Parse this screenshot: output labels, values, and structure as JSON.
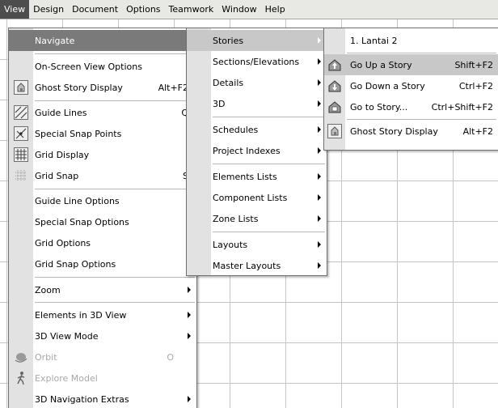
{
  "menubar": {
    "items": [
      "View",
      "Design",
      "Document",
      "Options",
      "Teamwork",
      "Window",
      "Help"
    ]
  },
  "view_menu": {
    "items": [
      {
        "label": "Navigate",
        "shortcut": "",
        "submenu": true
      },
      {
        "label": "On-Screen View Options",
        "shortcut": "",
        "submenu": true
      },
      {
        "label": "Ghost Story Display",
        "shortcut": "Alt+F2",
        "submenu": false
      },
      {
        "label": "Guide Lines",
        "shortcut": "Q",
        "submenu": false
      },
      {
        "label": "Special Snap Points",
        "shortcut": "",
        "submenu": false
      },
      {
        "label": "Grid Display",
        "shortcut": "",
        "submenu": false
      },
      {
        "label": "Grid Snap",
        "shortcut": "S",
        "submenu": false
      },
      {
        "label": "Guide Line Options",
        "shortcut": "",
        "submenu": true
      },
      {
        "label": "Special Snap Options",
        "shortcut": "",
        "submenu": true
      },
      {
        "label": "Grid Options",
        "shortcut": "",
        "submenu": true
      },
      {
        "label": "Grid Snap Options",
        "shortcut": "",
        "submenu": true
      },
      {
        "label": "Zoom",
        "shortcut": "",
        "submenu": true
      },
      {
        "label": "Elements in 3D View",
        "shortcut": "",
        "submenu": true
      },
      {
        "label": "3D View Mode",
        "shortcut": "",
        "submenu": true
      },
      {
        "label": "Orbit",
        "shortcut": "O",
        "submenu": false,
        "disabled": true
      },
      {
        "label": "Explore Model",
        "shortcut": "",
        "submenu": false,
        "disabled": true
      },
      {
        "label": "3D Navigation Extras",
        "shortcut": "",
        "submenu": true
      }
    ]
  },
  "navigate_menu": {
    "items": [
      {
        "label": "Stories"
      },
      {
        "label": "Sections/Elevations"
      },
      {
        "label": "Details"
      },
      {
        "label": "3D"
      },
      {
        "label": "Schedules"
      },
      {
        "label": "Project Indexes"
      },
      {
        "label": "Elements Lists"
      },
      {
        "label": "Component Lists"
      },
      {
        "label": "Zone Lists"
      },
      {
        "label": "Layouts"
      },
      {
        "label": "Master Layouts"
      }
    ]
  },
  "stories_menu": {
    "items": [
      {
        "label": "1. Lantai 2",
        "shortcut": ""
      },
      {
        "label": "Go Up a Story",
        "shortcut": "Shift+F2"
      },
      {
        "label": "Go Down a Story",
        "shortcut": "Ctrl+F2"
      },
      {
        "label": "Go to Story...",
        "shortcut": "Ctrl+Shift+F2"
      },
      {
        "label": "Ghost Story Display",
        "shortcut": "Alt+F2"
      }
    ]
  },
  "colors": {
    "highlight": "#7a7a7a",
    "highlight_light": "#c8c8c8",
    "menubar_active": "#4d4d4d",
    "gutter": "#e2e2e2",
    "disabled_text": "#a8a8a8"
  }
}
